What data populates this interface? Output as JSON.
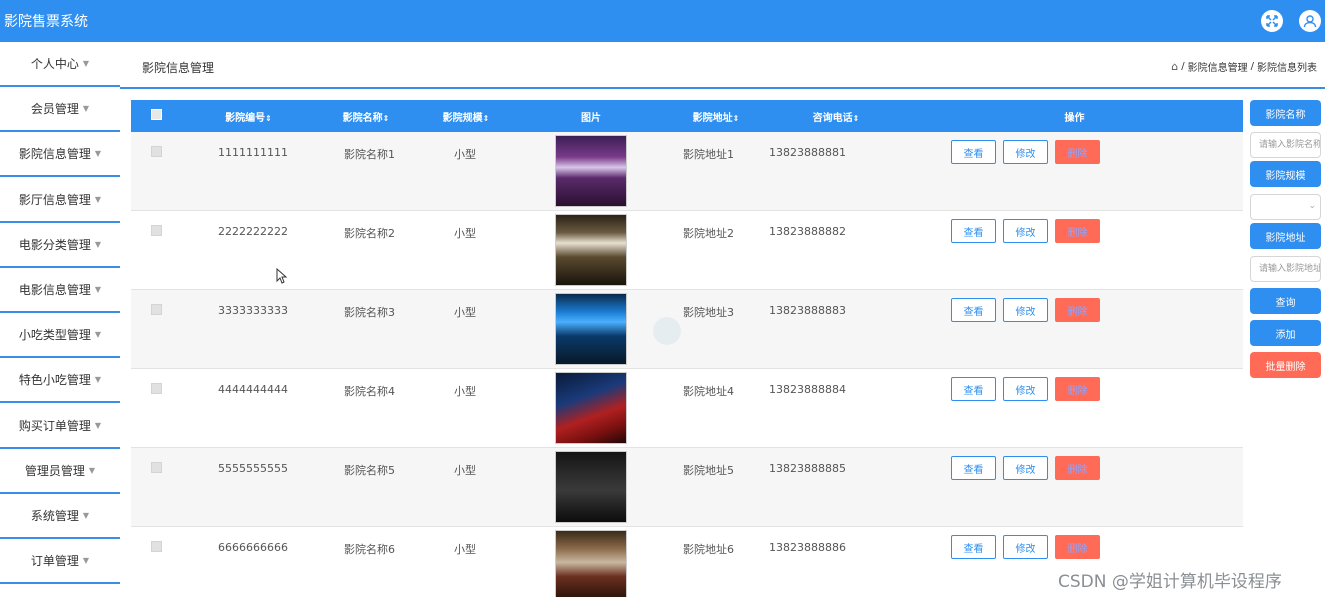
{
  "app": {
    "title": "影院售票系统"
  },
  "sidebar": {
    "items": [
      {
        "label": "个人中心"
      },
      {
        "label": "会员管理"
      },
      {
        "label": "影院信息管理"
      },
      {
        "label": "影厅信息管理"
      },
      {
        "label": "电影分类管理"
      },
      {
        "label": "电影信息管理"
      },
      {
        "label": "小吃类型管理"
      },
      {
        "label": "特色小吃管理"
      },
      {
        "label": "购买订单管理"
      },
      {
        "label": "管理员管理"
      },
      {
        "label": "系统管理"
      },
      {
        "label": "订单管理"
      }
    ]
  },
  "header": {
    "page_title": "影院信息管理",
    "breadcrumb": [
      "影院信息管理",
      "影院信息列表"
    ],
    "separator": "/"
  },
  "table": {
    "columns": [
      "影院编号",
      "影院名称",
      "影院规模",
      "图片",
      "影院地址",
      "咨询电话",
      "操作"
    ],
    "rows": [
      {
        "id": "1111111111",
        "name": "影院名称1",
        "scale": "小型",
        "address": "影院地址1",
        "phone": "13823888881"
      },
      {
        "id": "2222222222",
        "name": "影院名称2",
        "scale": "小型",
        "address": "影院地址2",
        "phone": "13823888882"
      },
      {
        "id": "3333333333",
        "name": "影院名称3",
        "scale": "小型",
        "address": "影院地址3",
        "phone": "13823888883"
      },
      {
        "id": "4444444444",
        "name": "影院名称4",
        "scale": "小型",
        "address": "影院地址4",
        "phone": "13823888884"
      },
      {
        "id": "5555555555",
        "name": "影院名称5",
        "scale": "小型",
        "address": "影院地址5",
        "phone": "13823888885"
      },
      {
        "id": "6666666666",
        "name": "影院名称6",
        "scale": "小型",
        "address": "影院地址6",
        "phone": "13823888886"
      }
    ],
    "actions": {
      "view": "查看",
      "edit": "修改",
      "delete": "删除"
    }
  },
  "search_panel": {
    "name_label": "影院名称",
    "name_placeholder": "请输入影院名称",
    "scale_label": "影院规模",
    "scale_value": "",
    "address_label": "影院地址",
    "address_placeholder": "请输入影院地址",
    "query": "查询",
    "add": "添加",
    "batch_delete": "批量删除"
  },
  "watermark": "CSDN @学姐计算机毕设程序",
  "colors": {
    "primary": "#2f8ff0",
    "danger": "#ff6b57"
  }
}
